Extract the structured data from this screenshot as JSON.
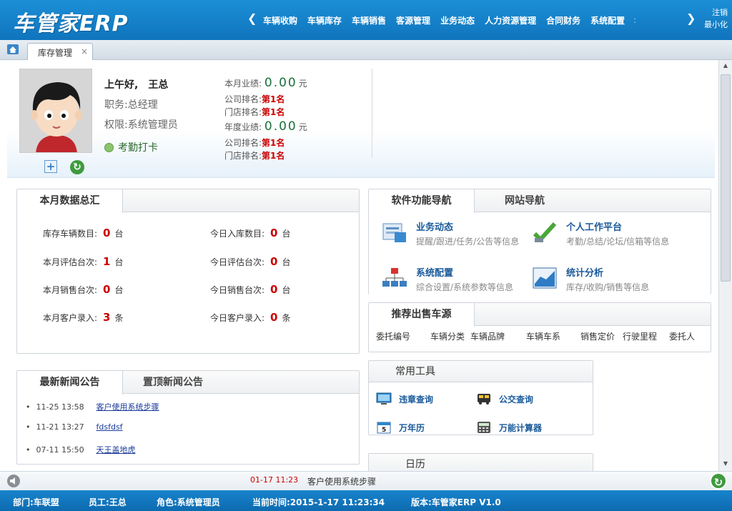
{
  "app": {
    "logo": "车管家ERP",
    "nav": [
      "车辆收购",
      "车辆库存",
      "车辆销售",
      "客源管理",
      "业务动态",
      "人力资源管理",
      "合同财务",
      "系统配置"
    ],
    "nav_more": ":",
    "logout": "注销",
    "minimize": "最小化"
  },
  "tabs": [
    {
      "label": "库存管理",
      "close": "×"
    }
  ],
  "user": {
    "greeting": "上午好,",
    "name": "王总",
    "position": "职务:总经理",
    "permission": "权限:系统管理员",
    "punch": "考勤打卡",
    "monthly_perf_label": "本月业绩:",
    "monthly_perf_value": "0.00",
    "yearly_perf_label": "年度业绩:",
    "yearly_perf_value": "0.00",
    "unit_yuan": "元",
    "company_rank_label": "公司排名:",
    "store_rank_label": "门店排名:",
    "rank_value": "第1名"
  },
  "monthly": {
    "tab": "本月数据总汇",
    "stats": [
      {
        "label": "库存车辆数目:",
        "value": "0",
        "unit": "台"
      },
      {
        "label": "今日入库数目:",
        "value": "0",
        "unit": "台"
      },
      {
        "label": "本月评估台次:",
        "value": "1",
        "unit": "台"
      },
      {
        "label": "今日评估台次:",
        "value": "0",
        "unit": "台"
      },
      {
        "label": "本月销售台次:",
        "value": "0",
        "unit": "台"
      },
      {
        "label": "今日销售台次:",
        "value": "0",
        "unit": "台"
      },
      {
        "label": "本月客户录入:",
        "value": "3",
        "unit": "条"
      },
      {
        "label": "今日客户录入:",
        "value": "0",
        "unit": "条"
      }
    ]
  },
  "feature_nav": {
    "tabs": [
      "软件功能导航",
      "网站导航"
    ],
    "items": [
      {
        "title": "业务动态",
        "desc": "提醒/跟进/任务/公告等信息",
        "icon": "business-news-icon"
      },
      {
        "title": "个人工作平台",
        "desc": "考勤/总结/论坛/信箱等信息",
        "icon": "personal-workbench-icon"
      },
      {
        "title": "系统配置",
        "desc": "综合设置/系统参数等信息",
        "icon": "system-config-icon"
      },
      {
        "title": "统计分析",
        "desc": "库存/收购/销售等信息",
        "icon": "statistics-icon"
      }
    ]
  },
  "recommend": {
    "tab": "推荐出售车源",
    "columns": [
      "委托编号",
      "车辆分类",
      "车辆品牌",
      "车辆车系",
      "销售定价",
      "行驶里程",
      "委托人"
    ]
  },
  "news": {
    "tabs": [
      "最新新闻公告",
      "置顶新闻公告"
    ],
    "items": [
      {
        "bullet": "•",
        "time": "11-25 13:58",
        "title": "客户使用系统步骤"
      },
      {
        "bullet": "•",
        "time": "11-21 13:27",
        "title": "fdsfdsf"
      },
      {
        "bullet": "•",
        "time": "07-11 15:50",
        "title": "天王盖地虎"
      }
    ]
  },
  "tools": {
    "title": "常用工具",
    "items": [
      {
        "label": "违章查询",
        "icon": "traffic-violation-icon"
      },
      {
        "label": "公交查询",
        "icon": "bus-icon"
      },
      {
        "label": "万年历",
        "icon": "calendar-icon"
      },
      {
        "label": "万能计算器",
        "icon": "calculator-icon"
      }
    ]
  },
  "calendar": {
    "title": "日历"
  },
  "ticker": {
    "time": "01-17 11:23",
    "message": "客户使用系统步骤"
  },
  "status": {
    "dept": "部门:车联盟",
    "staff": "员工:王总",
    "role": "角色:系统管理员",
    "time": "当前时间:2015-1-17 11:23:34",
    "version": "版本:车管家ERP V1.0"
  },
  "colors": {
    "brand": "#1279c4",
    "rank": "#cc0000",
    "perf": "#1a6f3a",
    "link": "#1a3a9a"
  }
}
